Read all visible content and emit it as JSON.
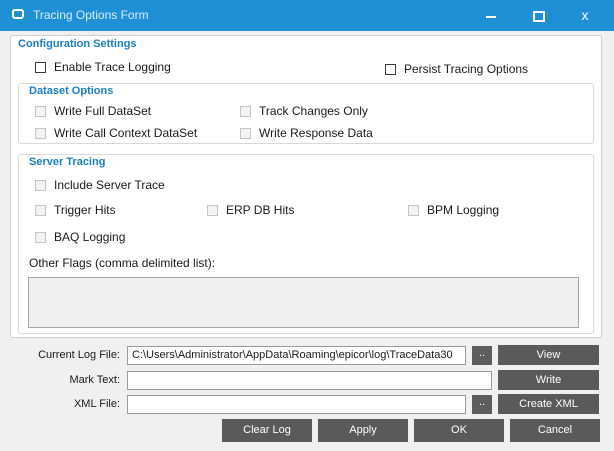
{
  "window": {
    "title": "Tracing Options Form",
    "minimize_icon": "minimize-icon",
    "maximize_icon": "maximize-icon",
    "close_icon": "close-icon",
    "close_glyph": "x"
  },
  "config": {
    "title": "Configuration Settings",
    "enable_trace_logging": {
      "label": "Enable Trace Logging",
      "checked": false
    },
    "persist_tracing_options": {
      "label": "Persist Tracing Options",
      "checked": false
    }
  },
  "dataset": {
    "title": "Dataset Options",
    "write_full_dataset": {
      "label": "Write Full DataSet",
      "checked": false,
      "enabled": false
    },
    "track_changes_only": {
      "label": "Track Changes Only",
      "checked": false,
      "enabled": false
    },
    "write_call_context": {
      "label": "Write Call Context DataSet",
      "checked": false,
      "enabled": false
    },
    "write_response_data": {
      "label": "Write Response Data",
      "checked": false,
      "enabled": false
    }
  },
  "server": {
    "title": "Server Tracing",
    "include_server_trace": {
      "label": "Include Server Trace",
      "checked": false,
      "enabled": false
    },
    "trigger_hits": {
      "label": "Trigger Hits",
      "checked": false,
      "enabled": false
    },
    "erp_db_hits": {
      "label": "ERP DB Hits",
      "checked": false,
      "enabled": false
    },
    "bpm_logging": {
      "label": "BPM Logging",
      "checked": false,
      "enabled": false
    },
    "baq_logging": {
      "label": "BAQ Logging",
      "checked": false,
      "enabled": false
    },
    "other_flags_label": "Other Flags (comma delimited list):",
    "other_flags_value": ""
  },
  "files": {
    "current_log_label": "Current Log File:",
    "current_log_value": "C:\\Users\\Administrator\\AppData\\Roaming\\epicor\\log\\TraceData30",
    "browse_label": "..",
    "view_label": "View",
    "mark_text_label": "Mark Text:",
    "mark_text_value": "",
    "write_label": "Write",
    "xml_file_label": "XML File:",
    "xml_file_value": "",
    "create_xml_label": "Create XML"
  },
  "footer": {
    "clear_log": "Clear Log",
    "apply": "Apply",
    "ok": "OK",
    "cancel": "Cancel"
  },
  "colors": {
    "titlebar": "#1f8fd6",
    "group_title": "#1b7fc4",
    "button": "#5a5a5a"
  }
}
